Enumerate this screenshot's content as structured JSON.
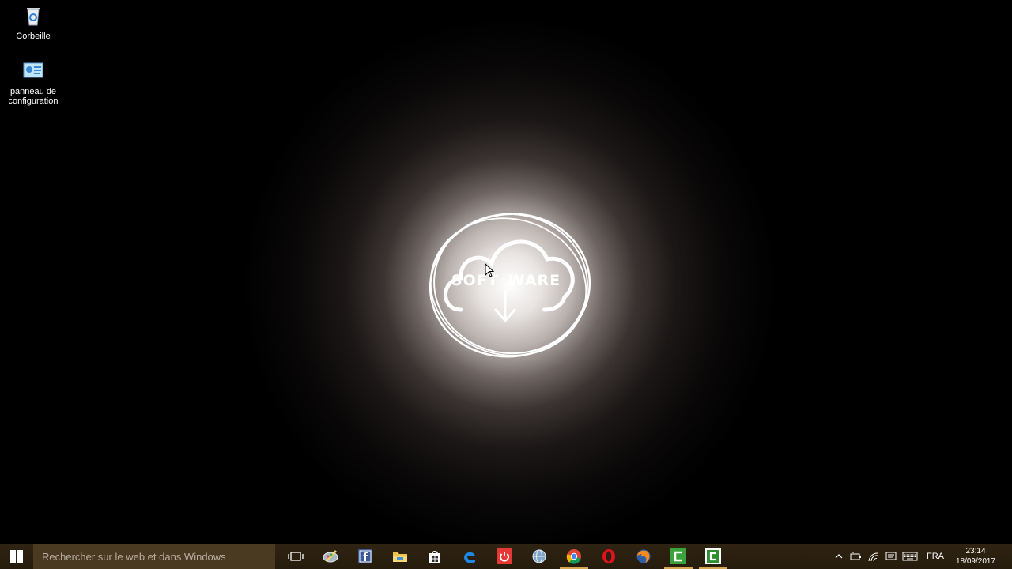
{
  "desktop": {
    "icons": [
      {
        "label": "Corbeille",
        "icon": "recycle-bin-icon"
      },
      {
        "label": "panneau de configuration",
        "icon": "control-panel-icon"
      }
    ],
    "wallpaper": {
      "logo_left": "SOFT",
      "logo_right": "WARE",
      "accent": "#ffffff"
    }
  },
  "taskbar": {
    "search_placeholder": "Rechercher sur le web et dans Windows",
    "apps": [
      {
        "name": "task-view",
        "icon": "task-view-icon"
      },
      {
        "name": "paint-tool",
        "icon": "paint-icon"
      },
      {
        "name": "facebook",
        "icon": "facebook-icon"
      },
      {
        "name": "file-explorer",
        "icon": "folder-icon"
      },
      {
        "name": "store",
        "icon": "store-icon"
      },
      {
        "name": "edge",
        "icon": "edge-icon"
      },
      {
        "name": "power-app",
        "icon": "power-icon"
      },
      {
        "name": "globe-app",
        "icon": "globe-icon"
      },
      {
        "name": "chrome",
        "icon": "chrome-icon"
      },
      {
        "name": "opera",
        "icon": "opera-icon"
      },
      {
        "name": "firefox",
        "icon": "firefox-icon"
      },
      {
        "name": "camtasia-1",
        "icon": "camtasia-icon"
      },
      {
        "name": "camtasia-2",
        "icon": "camtasia-recorder-icon"
      }
    ],
    "tray": {
      "language": "FRA",
      "time": "23:14",
      "date": "18/09/2017"
    },
    "colors": {
      "background": "#2a1f10",
      "search_bg": "#4b3a22",
      "active_underline": "#d6a550"
    }
  }
}
